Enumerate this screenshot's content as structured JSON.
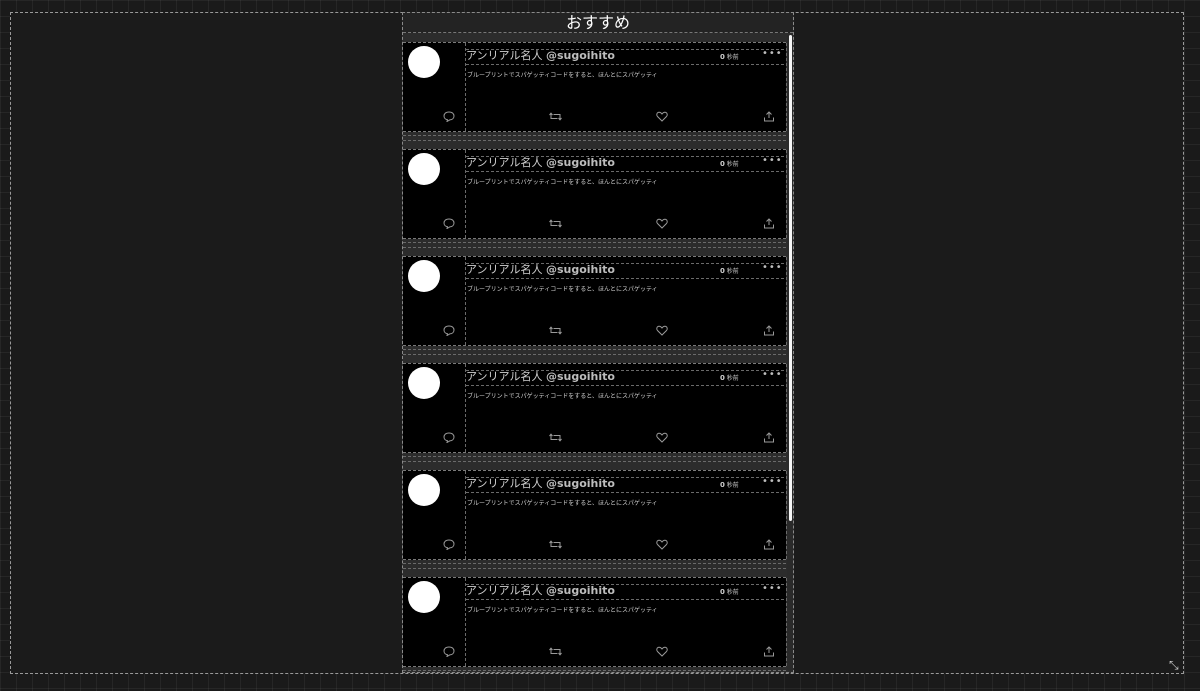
{
  "feed": {
    "title": "おすすめ"
  },
  "posts": [
    {
      "display_name": "アンリアル名人",
      "handle": "@sugoihito",
      "time_value": "0",
      "time_unit": "秒前",
      "more": "•••",
      "text": "ブループリントでスパゲッティコードをすると、ほんとにスパゲッティ"
    },
    {
      "display_name": "アンリアル名人",
      "handle": "@sugoihito",
      "time_value": "0",
      "time_unit": "秒前",
      "more": "•••",
      "text": "ブループリントでスパゲッティコードをすると、ほんとにスパゲッティ"
    },
    {
      "display_name": "アンリアル名人",
      "handle": "@sugoihito",
      "time_value": "0",
      "time_unit": "秒前",
      "more": "•••",
      "text": "ブループリントでスパゲッティコードをすると、ほんとにスパゲッティ"
    },
    {
      "display_name": "アンリアル名人",
      "handle": "@sugoihito",
      "time_value": "0",
      "time_unit": "秒前",
      "more": "•••",
      "text": "ブループリントでスパゲッティコードをすると、ほんとにスパゲッティ"
    },
    {
      "display_name": "アンリアル名人",
      "handle": "@sugoihito",
      "time_value": "0",
      "time_unit": "秒前",
      "more": "•••",
      "text": "ブループリントでスパゲッティコードをすると、ほんとにスパゲッティ"
    },
    {
      "display_name": "アンリアル名人",
      "handle": "@sugoihito",
      "time_value": "0",
      "time_unit": "秒前",
      "more": "•••",
      "text": "ブループリントでスパゲッティコードをすると、ほんとにスパゲッティ"
    }
  ],
  "icons": {
    "reply": "reply-icon",
    "repost": "repost-icon",
    "like": "like-icon",
    "share": "share-icon",
    "resize": "resize-icon"
  },
  "colors": {
    "background": "#1b1b1b",
    "post_background": "#000000",
    "avatar": "#ffffff",
    "text": "#d0d0d0",
    "scrollbar": "#f5f5f5"
  }
}
